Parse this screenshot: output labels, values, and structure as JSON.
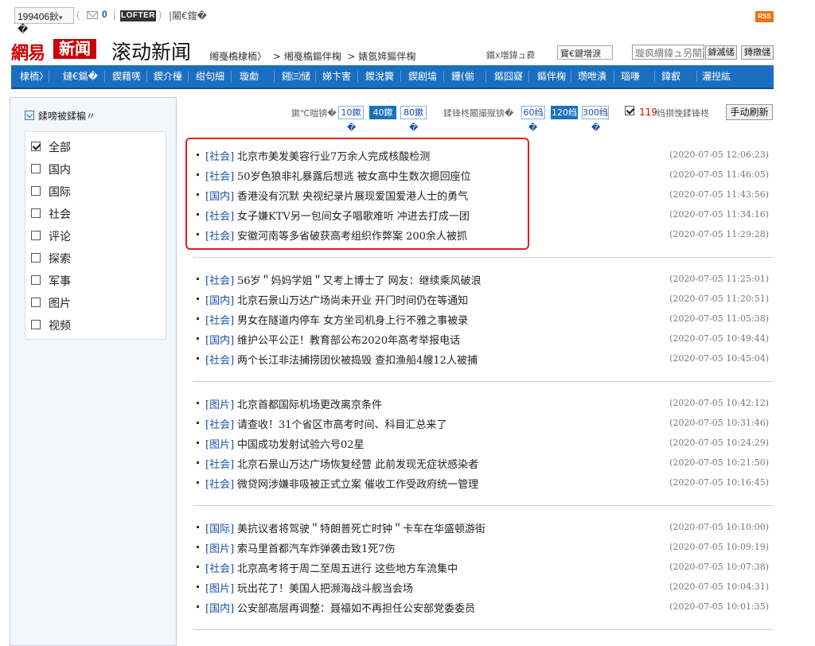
{
  "topbar": {
    "user": "199406鈥",
    "user_extra": "�",
    "paren_open": "(",
    "mail_count": "0",
    "sep": "|",
    "lofter": "LOFTER",
    "paren_close": ")",
    "logout": "|闂€鍑�",
    "rss": "RSS"
  },
  "header": {
    "logo_red": "網易",
    "logo_box": "新闻",
    "page_title": "滚动新闻",
    "breadcrumb": [
      "缃戞槗棣栭〉",
      "> 缃戞槗鏂伴椈",
      "> 婊氬姩鏂伴椈"
    ],
    "text1": "鐵х増鍏ュ彛",
    "select_value": "寳€鍵増淚",
    "search_placeholder": "璇疯緭鍏ュ叧閿瓧",
    "search_button": "鎼滅储",
    "adv_button": "鏄撴儲"
  },
  "nav": {
    "items": [
      {
        "label": "棣栭〉"
      },
      {
        "label": "鏈€鏂�"
      },
      {
        "label": "鍥藉唴"
      },
      {
        "label": "鍥介檯"
      },
      {
        "label": "绀句細"
      },
      {
        "label": "璇勮"
      },
      {
        "label": "鎺㈢储"
      },
      {
        "label": "娣卞害"
      },
      {
        "label": "鍐涗簨"
      },
      {
        "label": "鍥剧墖"
      },
      {
        "label": "鑸(偂"
      },
      {
        "label": "鏂囧寲"
      },
      {
        "label": "鏂伴椈"
      },
      {
        "label": "瓒呭潰"
      },
      {
        "label": "瑙嗛"
      },
      {
        "label": "鍏叡"
      },
      {
        "label": "灑揑紘"
      }
    ]
  },
  "sidebar": {
    "heading": "鍒嗙被鍒楄〃",
    "categories": [
      {
        "label": "全部",
        "checked": true
      },
      {
        "label": "国内",
        "checked": false
      },
      {
        "label": "国际",
        "checked": false
      },
      {
        "label": "社会",
        "checked": false
      },
      {
        "label": "评论",
        "checked": false
      },
      {
        "label": "探索",
        "checked": false
      },
      {
        "label": "军事",
        "checked": false
      },
      {
        "label": "图片",
        "checked": false
      },
      {
        "label": "视频",
        "checked": false
      }
    ]
  },
  "filter": {
    "page_size_label": "鏉℃暟锛�",
    "page_sizes": [
      "10鏉",
      "40鏉",
      "80鏉"
    ],
    "page_size_active": 1,
    "interval_label": "鍒锋柊闂撮殧锛�",
    "intervals": [
      "60绉",
      "120绉",
      "300绉"
    ],
    "interval_active": 1,
    "glyph": "�",
    "auto_count": "119",
    "auto_text": "绉掑悗鍒锋柊",
    "refresh_button": "手动刷新"
  },
  "news_groups": [
    [
      {
        "cat": "[社会]",
        "title": "北京市美发美容行业7万余人完成核酸检测",
        "time": "(2020-07-05 12:06:23)"
      },
      {
        "cat": "[社会]",
        "title": "50岁色狼非礼暴露后想逃 被女高中生数次摁回座位",
        "time": "(2020-07-05 11:46:05)"
      },
      {
        "cat": "[国内]",
        "title": "香港没有沉默 央视纪录片展现爱国爱港人士的勇气",
        "time": "(2020-07-05 11:43:56)"
      },
      {
        "cat": "[社会]",
        "title": "女子嫌KTV另一包间女子唱歌难听 冲进去打成一团",
        "time": "(2020-07-05 11:34:16)"
      },
      {
        "cat": "[社会]",
        "title": "安徽河南等多省破获高考组织作弊案 200余人被抓",
        "time": "(2020-07-05 11:29:28)"
      }
    ],
    [
      {
        "cat": "[社会]",
        "title": "56岁＂妈妈学姐＂又考上博士了 网友：继续乘风破浪",
        "time": "(2020-07-05 11:25:01)"
      },
      {
        "cat": "[国内]",
        "title": "北京石景山万达广场尚未开业 开门时间仍在等通知",
        "time": "(2020-07-05 11:20:51)"
      },
      {
        "cat": "[社会]",
        "title": "男女在隧道内停车 女方坐司机身上行不雅之事被录",
        "time": "(2020-07-05 11:05:38)"
      },
      {
        "cat": "[国内]",
        "title": "维护公平公正！教育部公布2020年高考举报电话",
        "time": "(2020-07-05 10:49:44)"
      },
      {
        "cat": "[社会]",
        "title": "两个长江非法捕捞团伙被捣毁 查扣渔船4艘12人被捕",
        "time": "(2020-07-05 10:45:04)"
      }
    ],
    [
      {
        "cat": "[图片]",
        "title": "北京首都国际机场更改离京条件",
        "time": "(2020-07-05 10:42:12)"
      },
      {
        "cat": "[社会]",
        "title": "请查收！31个省区市高考时间、科目汇总来了",
        "time": "(2020-07-05 10:31:46)"
      },
      {
        "cat": "[图片]",
        "title": "中国成功发射试验六号02星",
        "time": "(2020-07-05 10:24:29)"
      },
      {
        "cat": "[社会]",
        "title": "北京石景山万达广场恢复经营 此前发现无症状感染者",
        "time": "(2020-07-05 10:21:50)"
      },
      {
        "cat": "[社会]",
        "title": "微贷网涉嫌非吸被正式立案 催收工作受政府统一管理",
        "time": "(2020-07-05 10:16:45)"
      }
    ],
    [
      {
        "cat": "[国际]",
        "title": "美抗议者将驾驶＂特朗普死亡时钟＂卡车在华盛顿游街",
        "time": "(2020-07-05 10:10:00)"
      },
      {
        "cat": "[图片]",
        "title": "索马里首都汽车炸弹袭击致1死7伤",
        "time": "(2020-07-05 10:09:19)"
      },
      {
        "cat": "[社会]",
        "title": "北京高考将于周二至周五进行 这些地方车流集中",
        "time": "(2020-07-05 10:07:38)"
      },
      {
        "cat": "[图片]",
        "title": "玩出花了！美国人把濒海战斗舰当会场",
        "time": "(2020-07-05 10:04:31)"
      },
      {
        "cat": "[国内]",
        "title": "公安部高层再调整：聂福如不再担任公安部党委委员",
        "time": "(2020-07-05 10:01:35)"
      }
    ]
  ]
}
